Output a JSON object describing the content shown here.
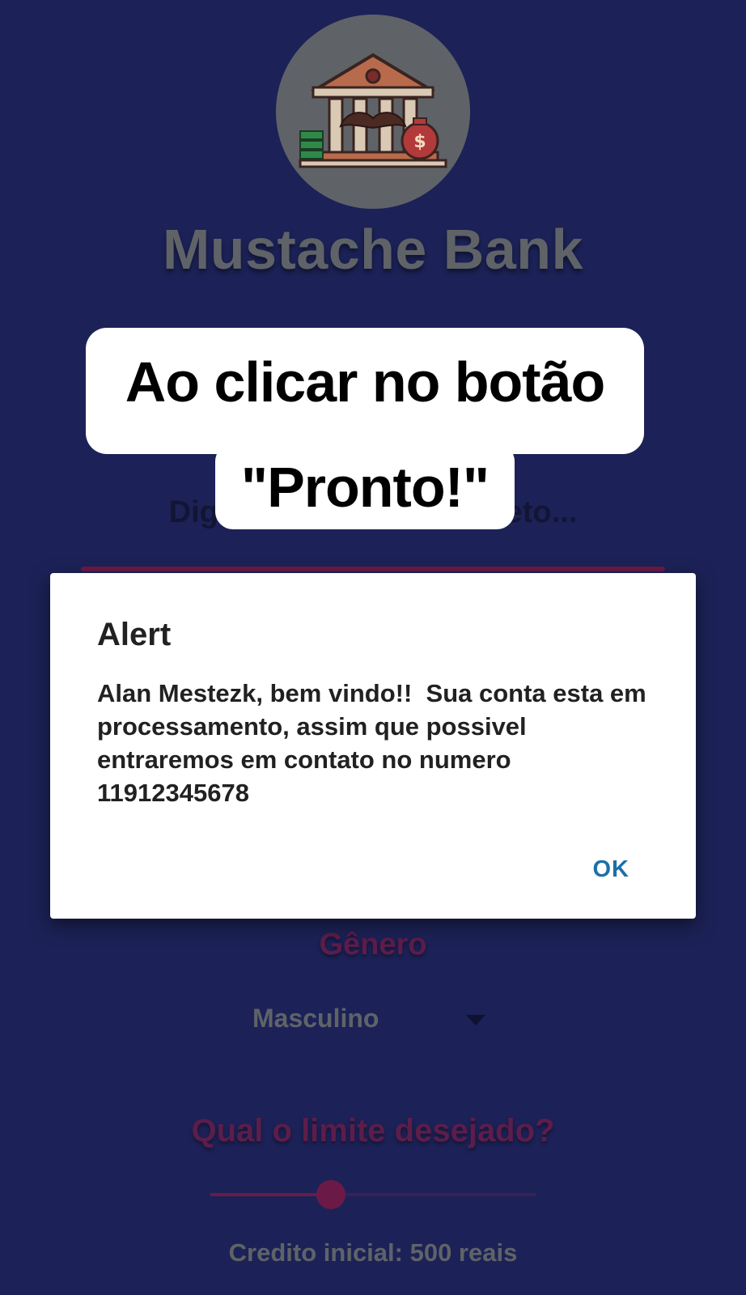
{
  "app": {
    "title": "Mustache Bank",
    "logo": "bank-building-with-mustache-logo"
  },
  "form": {
    "name_label": "Digite seu nome completo...",
    "gender_label": "Gênero",
    "gender_value": "Masculino",
    "limit_label": "Qual o limite desejado?",
    "limit_slider_fraction": 0.37,
    "credit_text": "Credito inicial: 500 reais"
  },
  "caption": {
    "line1": "Ao clicar no botão",
    "line2": "\"Pronto!\""
  },
  "dialog": {
    "title": "Alert",
    "message": "Alan Mestezk, bem vindo!!  Sua conta esta em processamento, assim que possivel entraremos em contato no numero 11912345678",
    "ok_label": "OK"
  },
  "colors": {
    "background": "#1c2257",
    "accent": "#6b1a48",
    "dialog_button": "#1e6fa6"
  }
}
